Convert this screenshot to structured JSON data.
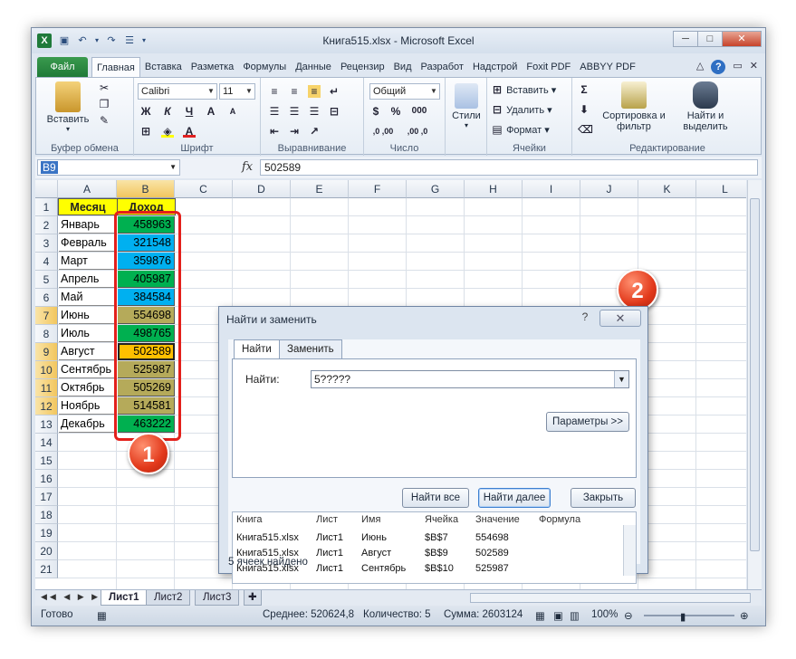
{
  "window": {
    "title": "Книга515.xlsx - Microsoft Excel",
    "app_icon": "X"
  },
  "ribbon_tabs": {
    "file": "Файл",
    "items": [
      "Главная",
      "Вставка",
      "Разметка",
      "Формулы",
      "Данные",
      "Рецензир",
      "Вид",
      "Разработ",
      "Надстрой",
      "Foxit PDF",
      "ABBYY PDF"
    ],
    "active_index": 0
  },
  "ribbon": {
    "clipboard": {
      "label": "Буфер обмена",
      "paste": "Вставить"
    },
    "font": {
      "label": "Шрифт",
      "name": "Calibri",
      "size": "11",
      "bold": "Ж",
      "italic": "К",
      "underline": "Ч"
    },
    "alignment": {
      "label": "Выравнивание"
    },
    "number": {
      "label": "Число",
      "format": "Общий",
      "percent": "%",
      "thousands": "000",
      "inc": ",0 ,00",
      "dec": ",00 ,0"
    },
    "styles": {
      "label": "Стили"
    },
    "cells": {
      "label": "Ячейки",
      "insert": "Вставить",
      "delete": "Удалить",
      "format": "Формат"
    },
    "editing": {
      "label": "Редактирование",
      "sort": "Сортировка и фильтр",
      "find": "Найти и выделить",
      "sigma": "Σ"
    }
  },
  "formula_bar": {
    "name_box": "B9",
    "fx": "fx",
    "value": "502589"
  },
  "columns": [
    "A",
    "B",
    "C",
    "D",
    "E",
    "F",
    "G",
    "H",
    "I",
    "J",
    "K",
    "L"
  ],
  "rows": [
    "1",
    "2",
    "3",
    "4",
    "5",
    "6",
    "7",
    "8",
    "9",
    "10",
    "11",
    "12",
    "13",
    "14",
    "15",
    "16",
    "17",
    "18",
    "19",
    "20",
    "21"
  ],
  "table": {
    "header_month": "Месяц",
    "header_income": "Доход",
    "data": [
      {
        "month": "Январь",
        "income": "458963",
        "color": "#00b050"
      },
      {
        "month": "Февраль",
        "income": "321548",
        "color": "#00b0f0"
      },
      {
        "month": "Март",
        "income": "359876",
        "color": "#00b0f0"
      },
      {
        "month": "Апрель",
        "income": "405987",
        "color": "#00b050"
      },
      {
        "month": "Май",
        "income": "384584",
        "color": "#00b0f0"
      },
      {
        "month": "Июнь",
        "income": "554698",
        "color": "#b5aa5a"
      },
      {
        "month": "Июль",
        "income": "498765",
        "color": "#00b050"
      },
      {
        "month": "Август",
        "income": "502589",
        "color": "#ffc000"
      },
      {
        "month": "Сентябрь",
        "income": "525987",
        "color": "#b5aa5a"
      },
      {
        "month": "Октябрь",
        "income": "505269",
        "color": "#b5aa5a"
      },
      {
        "month": "Ноябрь",
        "income": "514581",
        "color": "#b5aa5a"
      },
      {
        "month": "Декабрь",
        "income": "463222",
        "color": "#00b050"
      }
    ]
  },
  "sheets": {
    "tabs": [
      "Лист1",
      "Лист2",
      "Лист3"
    ],
    "active": "Лист1"
  },
  "status": {
    "ready": "Готово",
    "average": "Среднее: 520624,8",
    "count": "Количество: 5",
    "sum": "Сумма: 2603124",
    "zoom": "100%"
  },
  "dialog": {
    "title": "Найти и заменить",
    "help": "?",
    "tab_find": "Найти",
    "tab_replace": "Заменить",
    "find_label": "Найти:",
    "find_value": "5?????",
    "options": "Параметры >>",
    "find_all": "Найти все",
    "find_next": "Найти далее",
    "close": "Закрыть",
    "results_headers": [
      "Книга",
      "Лист",
      "Имя",
      "Ячейка",
      "Значение",
      "Формула"
    ],
    "results": [
      [
        "Книга515.xlsx",
        "Лист1",
        "Июнь",
        "$B$7",
        "554698",
        ""
      ],
      [
        "Книга515.xlsx",
        "Лист1",
        "Август",
        "$B$9",
        "502589",
        ""
      ],
      [
        "Книга515.xlsx",
        "Лист1",
        "Сентябрь",
        "$B$10",
        "525987",
        ""
      ]
    ],
    "status": "5 ячеек найдено"
  },
  "annotations": {
    "badge1": "1",
    "badge2": "2",
    "color": "#e3201b"
  }
}
